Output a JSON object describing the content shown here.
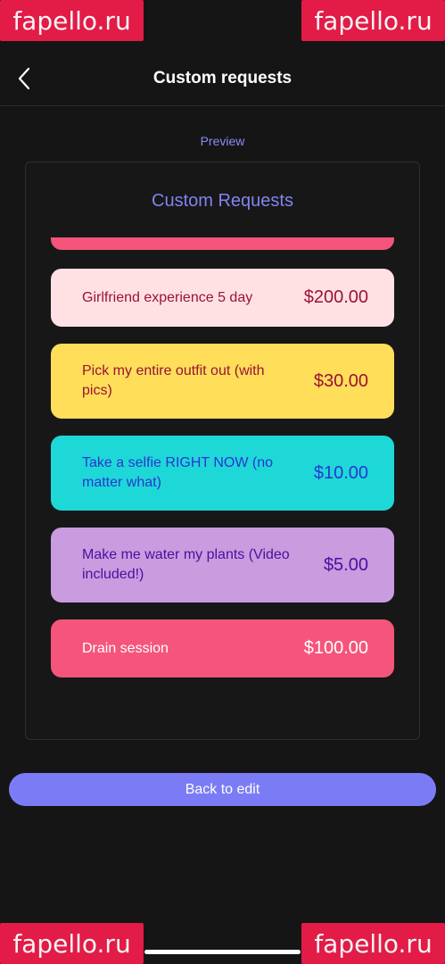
{
  "watermarks": {
    "top_left": "fapello.ru",
    "top_right": "fapello.ru",
    "bottom_left": "fapello.ru",
    "bottom_right": "fapello.ru"
  },
  "header": {
    "back_icon": "chevron-left-icon",
    "title": "Custom requests"
  },
  "preview": {
    "label": "Preview",
    "card_title": "Custom Requests",
    "items": [
      {
        "name": "Girlfriend experience 5 day",
        "price": "$200.00",
        "bg": "#ffe1e4",
        "fg": "#9b1235"
      },
      {
        "name": "Pick my entire outfit out (with pics)",
        "price": "$30.00",
        "bg": "#ffde59",
        "fg": "#9b1235"
      },
      {
        "name": "Take a selfie RIGHT NOW (no matter what)",
        "price": "$10.00",
        "bg": "#1ed8d8",
        "fg": "#2a36d0"
      },
      {
        "name": "Make me water my plants (Video included!)",
        "price": "$5.00",
        "bg": "#c99bdf",
        "fg": "#4b0f9e"
      },
      {
        "name": "Drain session",
        "price": "$100.00",
        "bg": "#f5557a",
        "fg": "#ffffff"
      }
    ],
    "partial_item_color": "#f5557a"
  },
  "actions": {
    "back_to_edit": "Back to edit",
    "accent": "#7b7cf5"
  }
}
